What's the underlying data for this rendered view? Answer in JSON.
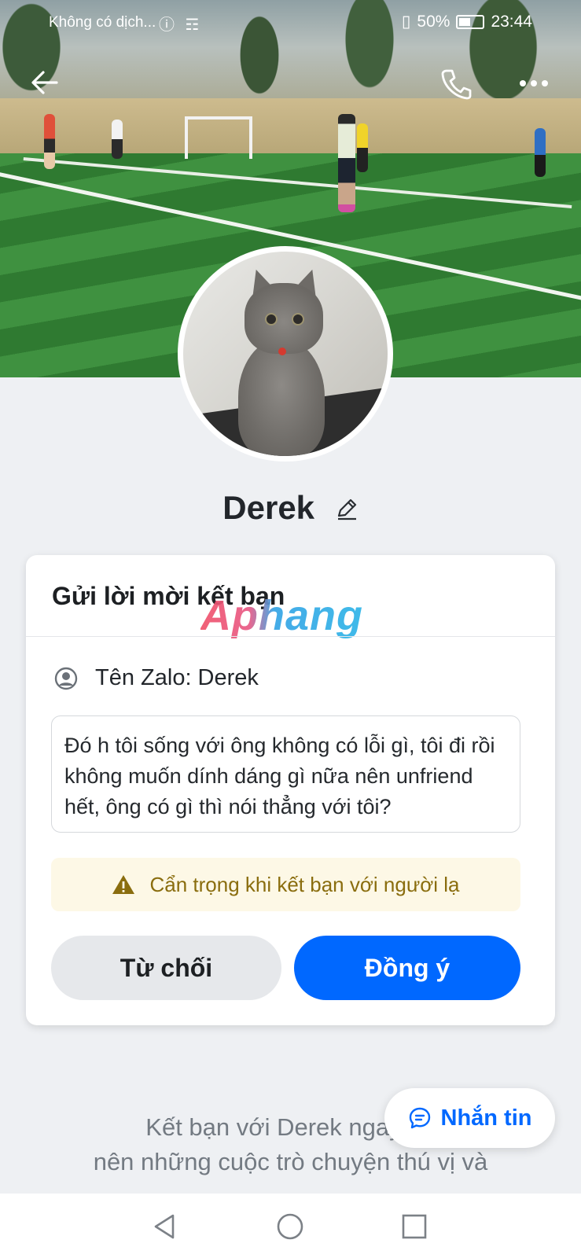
{
  "status_bar": {
    "carrier": "Không có dịch...",
    "battery": "50%",
    "time": "23:44"
  },
  "icons": {
    "back": "back-arrow-icon",
    "call": "phone-icon",
    "more": "more-dots-icon",
    "edit": "pencil-icon",
    "person": "person-circle-icon",
    "warning": "warning-triangle-icon",
    "chat": "chat-bubble-icon"
  },
  "profile": {
    "name": "Derek"
  },
  "friend_request_card": {
    "title": "Gửi lời mời kết bạn",
    "watermark": "Aphang",
    "zalo_name": "Tên Zalo: Derek",
    "message": "Đó h tôi sống với ông không có lỗi gì, tôi đi rồi không muốn dính dáng gì nữa nên unfriend hết,  ông có gì thì nói thẳng với tôi?",
    "warning": "Cẩn trọng khi kết bạn với người lạ",
    "decline_label": "Từ chối",
    "accept_label": "Đồng ý"
  },
  "promo": {
    "line1": "Kết bạn với Derek ngay để",
    "line2": "nên những cuộc trò chuyện thú vị và"
  },
  "chat_button": {
    "label": "Nhắn tin"
  },
  "colors": {
    "accent": "#0068ff",
    "warning_bg": "#fdf8e6",
    "warning_text": "#8a6d0e"
  }
}
